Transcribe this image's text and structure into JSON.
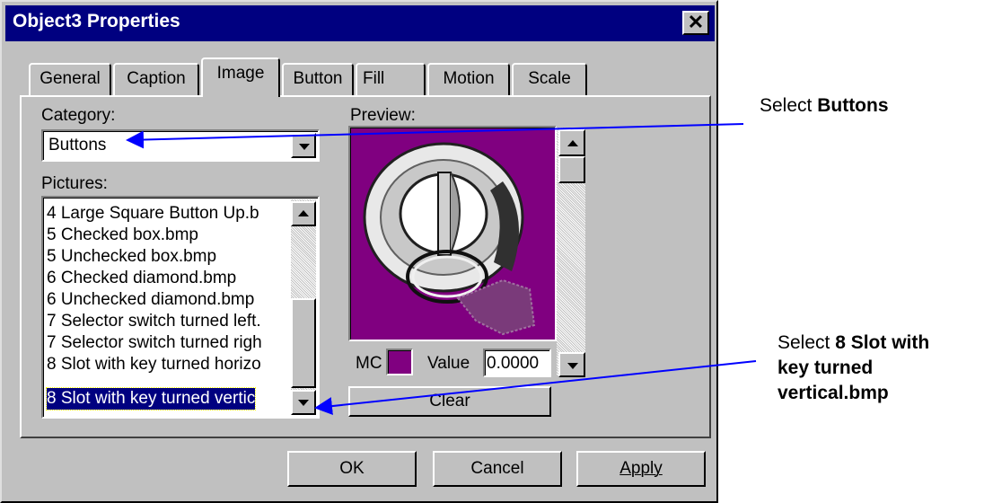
{
  "dialog": {
    "title": "Object3 Properties",
    "close_glyph": "✕",
    "tabs": [
      "General",
      "Caption",
      "Image",
      "Button",
      "Fill",
      "Motion",
      "Scale"
    ],
    "active_tab": "Image"
  },
  "image_tab": {
    "category_label": "Category:",
    "category_value": "Buttons",
    "pictures_label": "Pictures:",
    "pictures": [
      "4 Large Square Button Up.b",
      "5 Checked box.bmp",
      "5 Unchecked box.bmp",
      "6 Checked diamond.bmp",
      "6 Unchecked diamond.bmp",
      "7 Selector switch turned left.",
      "7 Selector switch turned righ",
      "8 Slot with key turned horizo",
      "8 Slot with key turned vertic"
    ],
    "selected_picture_index": 8,
    "preview_label": "Preview:",
    "mc_label": "MC",
    "mc_color": "#800080",
    "value_label": "Value",
    "value": "0.0000",
    "clear_label": "Clear",
    "preview_bg": "#800080"
  },
  "buttons": {
    "ok": "OK",
    "cancel": "Cancel",
    "apply": "Apply"
  },
  "callouts": {
    "c1_prefix": "Select ",
    "c1_bold": "Buttons",
    "c2_prefix": "Select ",
    "c2_bold_1": "8 Slot with",
    "c2_bold_2": "key turned",
    "c2_bold_3": "vertical.bmp",
    "arrow_color": "#0000ff"
  }
}
